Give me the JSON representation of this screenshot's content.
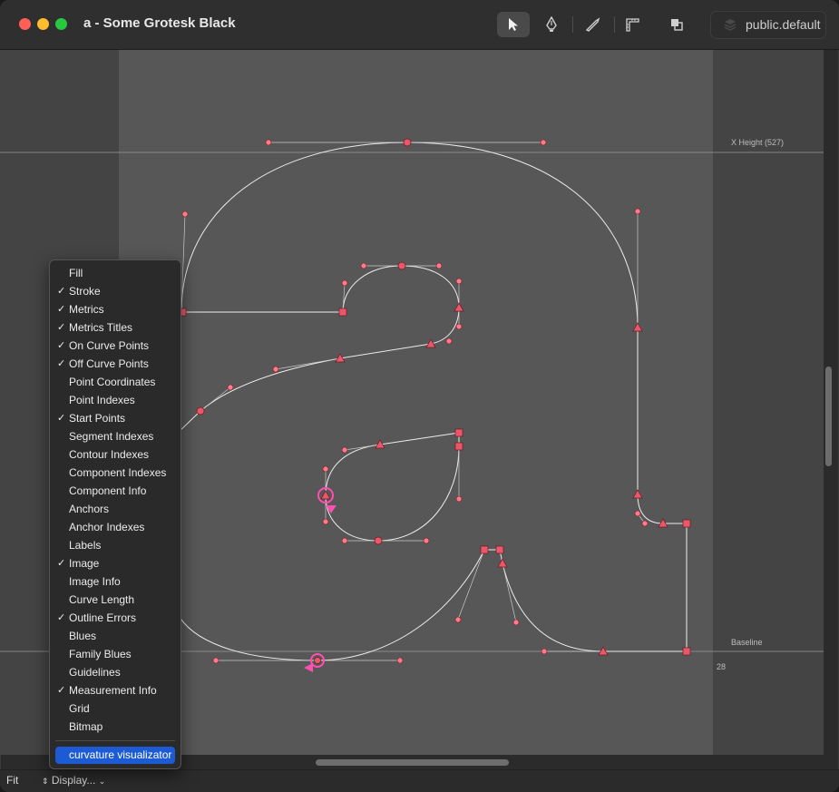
{
  "window": {
    "title": "a - Some Grotesk Black"
  },
  "toolbar": {
    "tools": [
      {
        "name": "pointer-tool",
        "icon": "arrow-pointer-icon",
        "active": true
      },
      {
        "name": "pen-tool",
        "icon": "pen-nib-icon",
        "active": false
      },
      {
        "name": "knife-tool",
        "icon": "knife-icon",
        "active": false
      },
      {
        "name": "measure-tool",
        "icon": "ruler-corner-icon",
        "active": false
      },
      {
        "name": "shapes-tool",
        "icon": "overlap-squares-icon",
        "active": false
      }
    ],
    "layer_label": "public.default",
    "layer_icon": "layers-icon"
  },
  "canvas": {
    "xheight_label": "X Height (527)",
    "baseline_label": "Baseline",
    "measurement_value": "28"
  },
  "bottombar": {
    "fit_label": "Fit",
    "display_label": "Display..."
  },
  "display_menu": {
    "items": [
      {
        "label": "Fill",
        "checked": false
      },
      {
        "label": "Stroke",
        "checked": true
      },
      {
        "label": "Metrics",
        "checked": true
      },
      {
        "label": "Metrics Titles",
        "checked": true
      },
      {
        "label": "On Curve Points",
        "checked": true
      },
      {
        "label": "Off Curve Points",
        "checked": true
      },
      {
        "label": "Point Coordinates",
        "checked": false
      },
      {
        "label": "Point Indexes",
        "checked": false
      },
      {
        "label": "Start Points",
        "checked": true
      },
      {
        "label": "Segment Indexes",
        "checked": false
      },
      {
        "label": "Contour Indexes",
        "checked": false
      },
      {
        "label": "Component Indexes",
        "checked": false
      },
      {
        "label": "Component Info",
        "checked": false
      },
      {
        "label": "Anchors",
        "checked": false
      },
      {
        "label": "Anchor Indexes",
        "checked": false
      },
      {
        "label": "Labels",
        "checked": false
      },
      {
        "label": "Image",
        "checked": true
      },
      {
        "label": "Image Info",
        "checked": false
      },
      {
        "label": "Curve Length",
        "checked": false
      },
      {
        "label": "Outline Errors",
        "checked": true
      },
      {
        "label": "Blues",
        "checked": false
      },
      {
        "label": "Family Blues",
        "checked": false
      },
      {
        "label": "Guidelines",
        "checked": false
      },
      {
        "label": "Measurement Info",
        "checked": true
      },
      {
        "label": "Grid",
        "checked": false
      },
      {
        "label": "Bitmap",
        "checked": false
      }
    ],
    "extra_item": {
      "label": "curvature visualizator",
      "selected": true
    },
    "check_glyph": "✓"
  },
  "colors": {
    "point": "#e8586a",
    "curve": "#ffffff",
    "accent": "#1c5bd3",
    "start_point": "#ff4fb0"
  }
}
